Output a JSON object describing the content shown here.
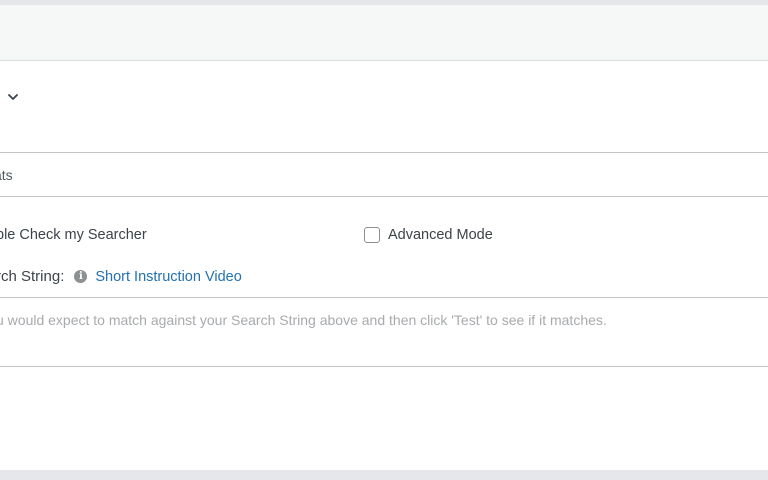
{
  "field": {
    "value": "ats"
  },
  "options": {
    "simple_check_label": "ble Check my Searcher",
    "advanced_mode_label": "Advanced Mode"
  },
  "search": {
    "label": "rch String:",
    "video_link": "Short Instruction Video"
  },
  "test": {
    "placeholder": "u would expect to match against your Search String above and then click 'Test' to see if it matches."
  },
  "icons": {
    "dropdown": "chevron-down-icon",
    "info": "info-icon"
  },
  "colors": {
    "link": "#2271b1",
    "border": "#c3c4c7",
    "panel": "#ffffff",
    "page_bg": "#f0f0f1"
  }
}
